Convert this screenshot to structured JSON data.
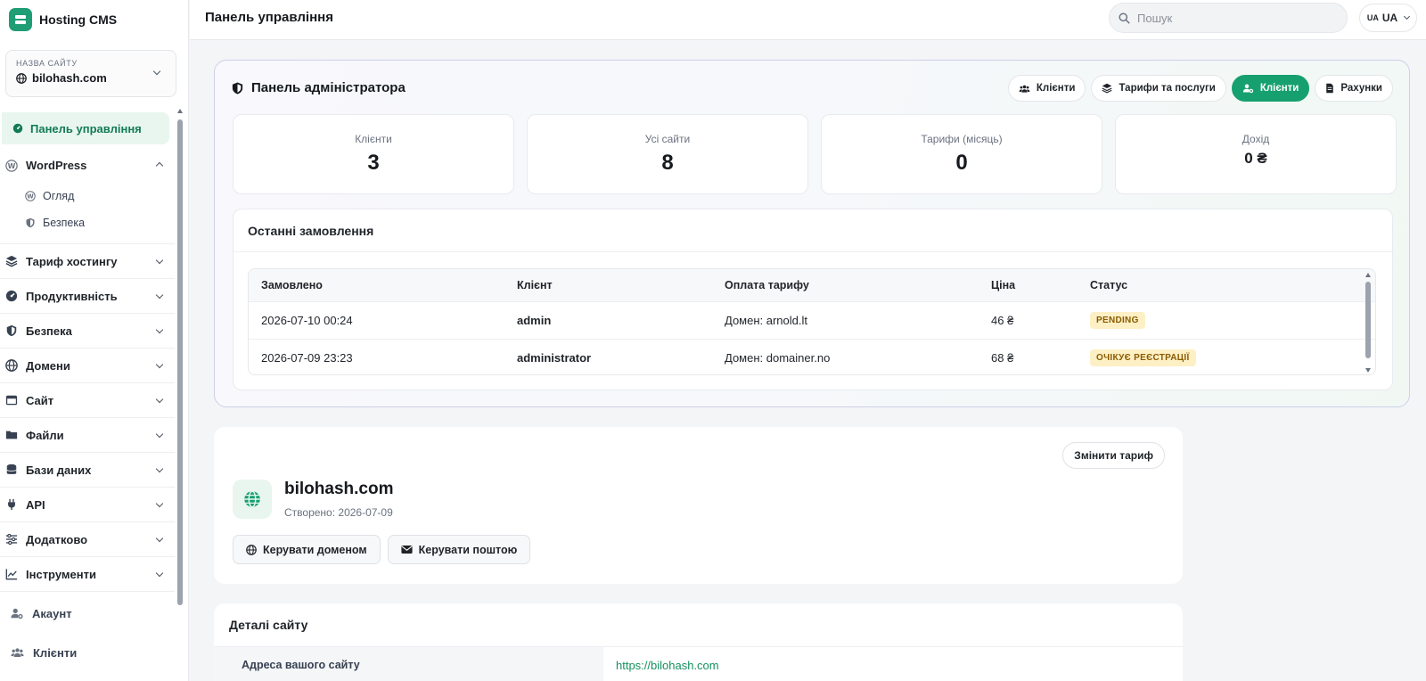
{
  "brand": {
    "name": "Hosting CMS"
  },
  "site_selector": {
    "label": "НАЗВА САЙТУ",
    "value": "bilohash.com"
  },
  "sidebar": {
    "active": "Панель управління",
    "wordpress": {
      "label": "WordPress",
      "subs": [
        "Огляд",
        "Безпека"
      ]
    },
    "items": [
      "Тариф хостингу",
      "Продуктивність",
      "Безпека",
      "Домени",
      "Сайт",
      "Файли",
      "Бази даних",
      "API",
      "Додатково",
      "Інструменти"
    ],
    "bottom": [
      "Акаунт",
      "Клієнти"
    ]
  },
  "topbar": {
    "title": "Панель управління",
    "search_placeholder": "Пошук",
    "lang_code": "UA",
    "lang_label": "UA"
  },
  "admin": {
    "title": "Панель адміністратора",
    "buttons": [
      "Клієнти",
      "Тарифи та послуги",
      "Клієнти",
      "Рахунки"
    ],
    "stats": [
      {
        "label": "Клієнти",
        "value": "3"
      },
      {
        "label": "Усі сайти",
        "value": "8"
      },
      {
        "label": "Тарифи (місяць)",
        "value": "0"
      },
      {
        "label": "Дохід",
        "value": "0 ₴"
      }
    ],
    "orders": {
      "title": "Останні замовлення",
      "headers": [
        "Замовлено",
        "Клієнт",
        "Оплата тарифу",
        "Ціна",
        "Статус"
      ],
      "rows": [
        {
          "date": "2026-07-10 00:24",
          "client": "admin",
          "plan": "Домен: arnold.lt",
          "price": "46 ₴",
          "status": "PENDING"
        },
        {
          "date": "2026-07-09 23:23",
          "client": "administrator",
          "plan": "Домен: domainer.no",
          "price": "68 ₴",
          "status": "ОЧІКУЄ РЕЄСТРАЦІЇ"
        }
      ]
    }
  },
  "site_card": {
    "change_plan": "Змінити тариф",
    "name": "bilohash.com",
    "created": "Створено: 2026-07-09",
    "manage_domain": "Керувати доменом",
    "manage_mail": "Керувати поштою"
  },
  "details": {
    "title": "Деталі сайту",
    "rows": [
      {
        "key": "Адреса вашого сайту",
        "value": "https://bilohash.com"
      }
    ]
  },
  "colors": {
    "accent": "#17a06f",
    "badge_bg": "#fdf0c5"
  }
}
